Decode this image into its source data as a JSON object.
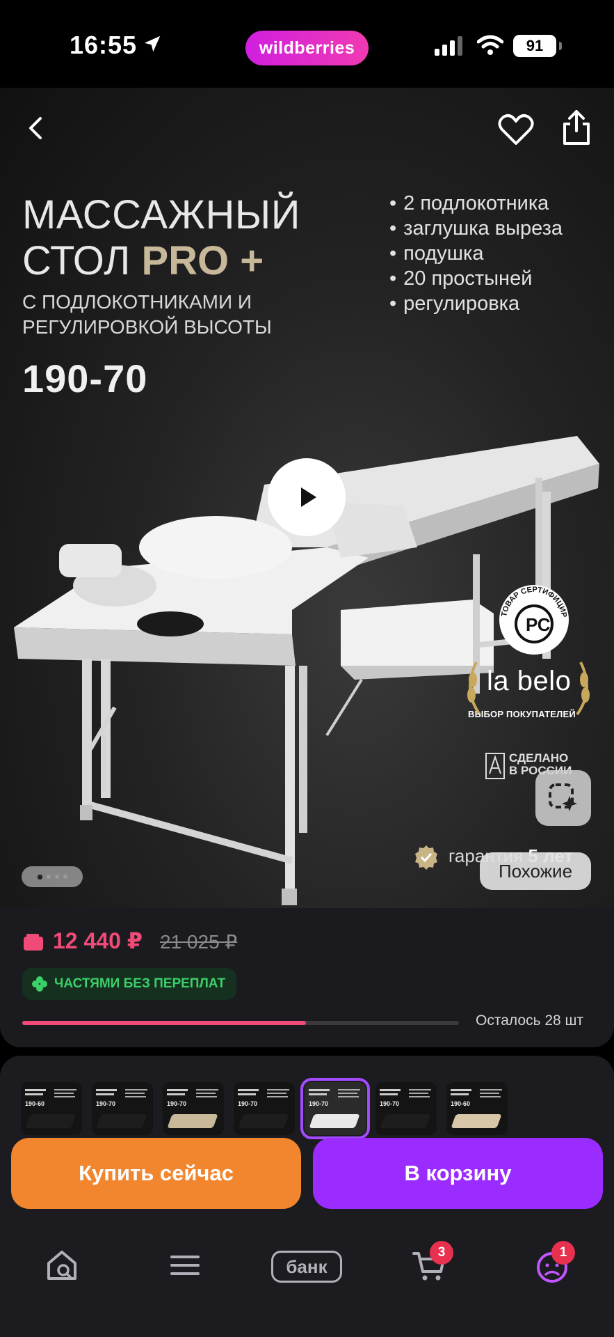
{
  "status_bar": {
    "time": "16:55",
    "app_pill": "wildberries",
    "battery": "91"
  },
  "hero": {
    "title_line1": "МАССАЖНЫЙ",
    "title_line2_prefix": "СТОЛ",
    "title_line2_brand": "PRO +",
    "subtitle": "С ПОДЛОКОТНИКАМИ И РЕГУЛИРОВКОЙ ВЫСОТЫ",
    "size": "190-70",
    "features": [
      "2 подлокотника",
      "заглушка выреза",
      "подушка",
      "20 простыней",
      "регулировка"
    ],
    "cert_text": "ТОВАР СЕРТИФИЦИРОВАН",
    "brand_logo": "la belo",
    "brand_sub": "ВЫБОР ПОКУПАТЕЛЕЙ",
    "made_in_line1": "СДЕЛАНО",
    "made_in_line2": "В РОССИИ",
    "guarantee_prefix": "гарантия",
    "guarantee_value": "5 лет",
    "similar_label": "Похожие",
    "gallery_count": 4,
    "gallery_active": 0
  },
  "price": {
    "current": "12 440 ₽",
    "old": "21 025 ₽",
    "installments": "ЧАСТЯМИ БЕЗ ПЕРЕПЛАТ",
    "stock_label": "Осталось 28 шт",
    "stock_fraction": 0.65
  },
  "thumbnails": {
    "count": 7,
    "selected_index": 4,
    "tones": [
      "#1d1d1d",
      "#1d1d1d",
      "#c9b89a",
      "#1d1d1d",
      "#e9e9e9",
      "#1d1d1d",
      "#d7c6a8"
    ],
    "labels": [
      "190-60",
      "190-70",
      "190-70",
      "190-70",
      "190-70",
      "190-70",
      "190-60"
    ]
  },
  "actions": {
    "buy_now": "Купить сейчас",
    "add_to_cart": "В корзину"
  },
  "tabbar": {
    "bank_label": "банк",
    "cart_badge": "3",
    "profile_badge": "1"
  },
  "colors": {
    "accent_purple": "#9b2cff",
    "buy_orange": "#f2862f",
    "price_pink": "#f04a78",
    "installments_green": "#3ccf6a",
    "brand_gold": "#c8b89a"
  }
}
